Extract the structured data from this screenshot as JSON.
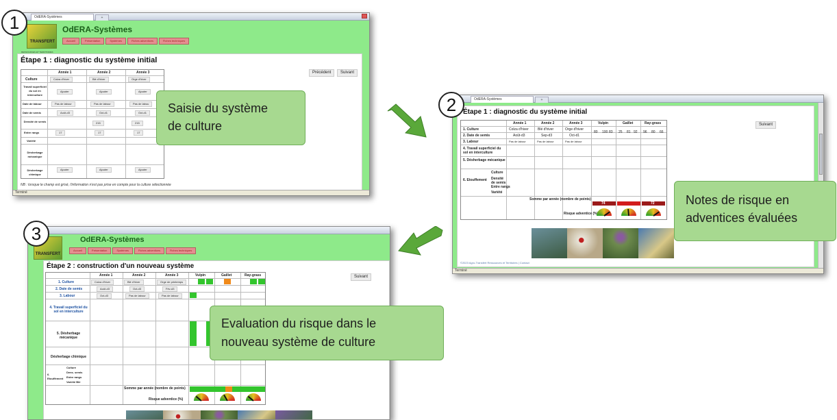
{
  "app": {
    "title": "OdERA-Systèmes",
    "logo_text": "TRANSFERT",
    "logo_subtext": "RESSOURCES ET TERRITOIRES",
    "status": "Terminé",
    "tab_title": "OdERA-Systèmes",
    "tab_new": "+"
  },
  "nav": [
    "Accueil",
    "Présentation",
    "Systèmes",
    "Fiches adventices",
    "Fiches techniques"
  ],
  "step1": {
    "number": "1",
    "heading": "Étape 1 : diagnostic du système initial",
    "prev": "Précédent",
    "next": "Suivant",
    "years": [
      "Année 1",
      "Année 2",
      "Année 3"
    ],
    "rows": [
      "Culture",
      "Travail superficiel du sol en interculture",
      "Date de labour",
      "Date de semis",
      "Densité de semis",
      "Entre rangs",
      "Variété",
      "Désherbage mécanique",
      "Désherbage chimique"
    ],
    "cultures": [
      "Colza d'hiver",
      "Blé d'hiver",
      "Orge d'hiver"
    ],
    "labour": [
      "Pas de labour",
      "Pas de labour",
      "Pas de labou"
    ],
    "semis": [
      "Août-d3",
      "Oct-d1",
      "Oct-d1"
    ],
    "densite": [
      "",
      "215",
      "215"
    ],
    "entre_rangs": [
      "17",
      "17",
      "17"
    ],
    "ajouter": "Ajouter",
    "note": "NB : lorsque le champ est grisé, l'information n'est pas prise en compte pour la culture sélectionnée",
    "callout": [
      "Saisie du système",
      "de culture"
    ]
  },
  "step2": {
    "number": "2",
    "heading": "Étape 1 : diagnostic du système initial",
    "next": "Suivant",
    "years": [
      "Année 1",
      "Année 2",
      "Année 3"
    ],
    "weeds": [
      "Vulpin",
      "Gaillet",
      "Ray-grass"
    ],
    "rows": [
      "1. Culture",
      "2. Date de semis",
      "3. Labour",
      "4. Travail superficiel du sol en interculture",
      "5. Désherbage mécanique",
      "6. Etouffement"
    ],
    "sub_rows": [
      "Culture",
      "Densité de semis",
      "Entre rangs",
      "Variété"
    ],
    "cultures": [
      "Colza d'hiver",
      "Blé d'hiver",
      "Orge d'hiver"
    ],
    "semis": [
      "Août-d3",
      "Sep-d3",
      "Oct-d1"
    ],
    "labour": [
      "Pas de labour",
      "Pas de labour",
      "Pas de labour"
    ],
    "score_row1": [
      "80",
      "100",
      "83",
      "25",
      "81",
      "92",
      "96",
      "80",
      "66"
    ],
    "sum_label": "Somme par année (nombre de points)",
    "sums": [
      "74",
      "",
      "72"
    ],
    "risk_label": "Risque adventice (%)",
    "footer": "©2023 Agro-Transfert Ressources et Territoires | Contact",
    "callout": [
      "Notes de risque en",
      "adventices évaluées"
    ]
  },
  "step3": {
    "number": "3",
    "heading": "Étape 2 : construction d'un nouveau système",
    "next": "Suivant",
    "years": [
      "Année 1",
      "Année 2",
      "Année 3"
    ],
    "weeds": [
      "Vulpin",
      "Gaillet",
      "Ray-grass"
    ],
    "rows": [
      "1. Culture",
      "2. Date de semis",
      "3. Labour",
      "4. Travail superficiel du sol en interculture",
      "5. Désherbage mécanique",
      "Désherbage chimique",
      "6. Etouffement"
    ],
    "sub_rows": [
      "Culture",
      "Dens. semis",
      "Entre rangs",
      "Variété Blé"
    ],
    "cultures": [
      "Colza d'hiver",
      "Blé d'hiver",
      "Orge de printemps"
    ],
    "semis": [
      "Août-d3",
      "Oct-d3",
      "Fév-d3"
    ],
    "labour": [
      "Oct-d3",
      "Pas de labour",
      "Pas de labour"
    ],
    "sum_label": "Somme par année (nombre de points)",
    "risk_label": "Risque adventice (%)",
    "callout": [
      "Evaluation du risque dans le",
      "nouveau système de culture"
    ]
  },
  "colors": {
    "page_green": "#8eea8a",
    "callout_fill": "#a7d990",
    "arrow": "#5aa83a",
    "nav": "#e48f90"
  }
}
